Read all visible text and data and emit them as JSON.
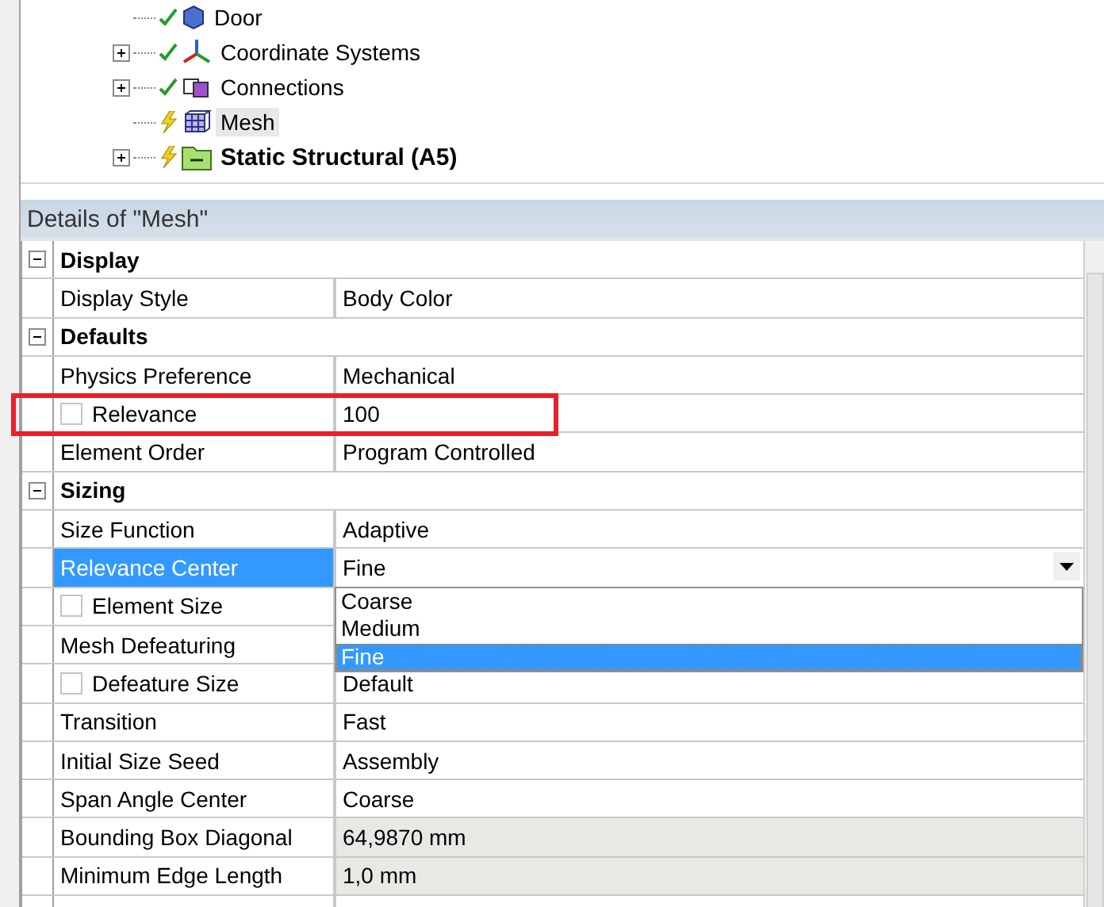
{
  "tree": {
    "items": [
      {
        "label": "Door",
        "kind": "part",
        "pending": false,
        "expander": false,
        "bold": false,
        "selected": false
      },
      {
        "label": "Coordinate Systems",
        "kind": "axes",
        "pending": false,
        "expander": true,
        "bold": false,
        "selected": false
      },
      {
        "label": "Connections",
        "kind": "connections",
        "pending": false,
        "expander": true,
        "bold": false,
        "selected": false
      },
      {
        "label": "Mesh",
        "kind": "mesh",
        "pending": true,
        "expander": false,
        "bold": false,
        "selected": true
      },
      {
        "label": "Static Structural (A5)",
        "kind": "analysis",
        "pending": true,
        "expander": true,
        "bold": true,
        "selected": false
      }
    ]
  },
  "details": {
    "title": "Details of \"Mesh\"",
    "rows": [
      {
        "kind": "group",
        "name": "Display",
        "expanded": true
      },
      {
        "kind": "prop",
        "name": "Display Style",
        "value": "Body Color"
      },
      {
        "kind": "group",
        "name": "Defaults",
        "expanded": true
      },
      {
        "kind": "prop",
        "name": "Physics Preference",
        "value": "Mechanical"
      },
      {
        "kind": "check",
        "name": "Relevance",
        "value": "100",
        "checked": false,
        "highlighted": true
      },
      {
        "kind": "prop",
        "name": "Element Order",
        "value": "Program Controlled"
      },
      {
        "kind": "group",
        "name": "Sizing",
        "expanded": true
      },
      {
        "kind": "prop",
        "name": "Size Function",
        "value": "Adaptive"
      },
      {
        "kind": "dropdown",
        "name": "Relevance Center",
        "value": "Fine",
        "selected": true,
        "options": [
          {
            "label": "Coarse",
            "selected": false
          },
          {
            "label": "Medium",
            "selected": false
          },
          {
            "label": "Fine",
            "selected": true
          }
        ]
      },
      {
        "kind": "check",
        "name": "Element Size",
        "checked": false
      },
      {
        "kind": "prop",
        "name": "Mesh Defeaturing"
      },
      {
        "kind": "check",
        "name": "Defeature Size",
        "value": "Default",
        "checked": false
      },
      {
        "kind": "prop",
        "name": "Transition",
        "value": "Fast"
      },
      {
        "kind": "prop",
        "name": "Initial Size Seed",
        "value": "Assembly"
      },
      {
        "kind": "prop",
        "name": "Span Angle Center",
        "value": "Coarse"
      },
      {
        "kind": "prop",
        "name": "Bounding Box Diagonal",
        "value": "64,9870 mm",
        "readonly": true
      },
      {
        "kind": "prop",
        "name": "Minimum Edge Length",
        "value": "1,0 mm",
        "readonly": true
      }
    ]
  }
}
